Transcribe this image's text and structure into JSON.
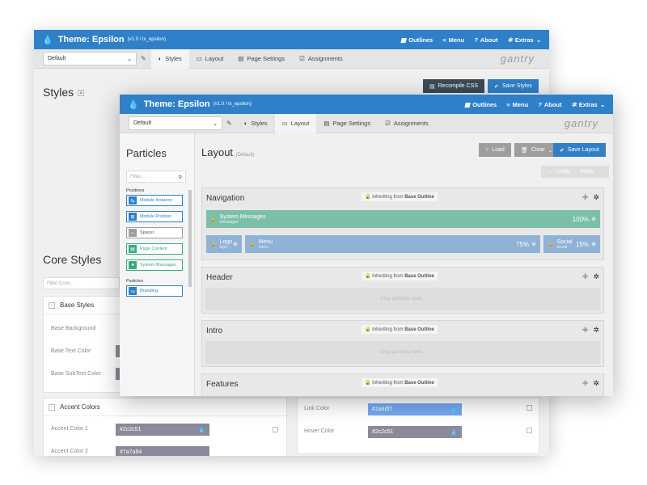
{
  "back": {
    "topbar": {
      "title": "Theme: Epsilon",
      "version": "(v1.0 / tx_epsilon)",
      "nav": [
        {
          "icon": "grid-icon",
          "glyph": "▦",
          "label": "Outlines"
        },
        {
          "icon": "menu-icon",
          "glyph": "≡",
          "label": "Menu"
        },
        {
          "icon": "help-icon",
          "glyph": "?",
          "label": "About"
        },
        {
          "icon": "gear-icon",
          "glyph": "✲",
          "label": "Extras"
        }
      ]
    },
    "outline_select": "Default",
    "tabs": [
      {
        "icon": "contrast-icon",
        "glyph": "◐",
        "label": "Styles",
        "active": true
      },
      {
        "icon": "layout-icon",
        "glyph": "▭",
        "label": "Layout",
        "active": false
      },
      {
        "icon": "list-icon",
        "glyph": "▤",
        "label": "Page Settings",
        "active": false
      },
      {
        "icon": "check-icon",
        "glyph": "☑",
        "label": "Assignments",
        "active": false
      }
    ],
    "brand": "gantry",
    "recompile_label": "Recompile CSS",
    "save_styles_label": "Save Styles",
    "styles_heading": "Styles",
    "core_styles_heading": "Core Styles",
    "filter_placeholder": "Filter Core...",
    "base_styles": {
      "title": "Base Styles",
      "fields": [
        "Base Background",
        "Base Text Color",
        "Base SubText Color"
      ]
    },
    "accent_colors": {
      "title": "Accent Colors",
      "fields": [
        {
          "label": "Accent Color 1",
          "value": "#2c2c51",
          "color": "#8a8a9a"
        },
        {
          "label": "Accent Color 2",
          "value": "#7a7a94",
          "color": "#8a8a9a"
        }
      ]
    },
    "link_colors": [
      {
        "label": "Link Color",
        "value": "#1a6df7",
        "color": "#75a8f0"
      },
      {
        "label": "Hover Color",
        "value": "#2c2c51",
        "color": "#8a8a9a"
      }
    ]
  },
  "front": {
    "topbar": {
      "title": "Theme: Epsilon",
      "version": "(v1.0 / tx_epsilon)",
      "nav": [
        {
          "icon": "grid-icon",
          "glyph": "▦",
          "label": "Outlines"
        },
        {
          "icon": "menu-icon",
          "glyph": "≡",
          "label": "Menu"
        },
        {
          "icon": "help-icon",
          "glyph": "?",
          "label": "About"
        },
        {
          "icon": "gear-icon",
          "glyph": "✲",
          "label": "Extras"
        }
      ]
    },
    "outline_select": "Default",
    "tabs": [
      {
        "icon": "contrast-icon",
        "glyph": "◐",
        "label": "Styles",
        "active": false
      },
      {
        "icon": "layout-icon",
        "glyph": "▭",
        "label": "Layout",
        "active": true
      },
      {
        "icon": "list-icon",
        "glyph": "▤",
        "label": "Page Settings",
        "active": false
      },
      {
        "icon": "check-icon",
        "glyph": "☑",
        "label": "Assignments",
        "active": false
      }
    ],
    "brand": "gantry",
    "particles_heading": "Particles",
    "filter_placeholder": "Filter...",
    "positions_label": "Positions",
    "particles_label": "Particles",
    "particle_items": [
      {
        "label": "Module Instance",
        "color": "#2f80c8",
        "glyph": "⇆"
      },
      {
        "label": "Module Position",
        "color": "#2f80c8",
        "glyph": "⊞"
      },
      {
        "label": "Spacer",
        "color": "#9e9e9e",
        "glyph": "↔"
      },
      {
        "label": "Page Content",
        "color": "#3aaa7e",
        "glyph": "▤"
      },
      {
        "label": "System Messages",
        "color": "#3aaa7e",
        "glyph": "●"
      },
      {
        "label": "Branding",
        "color": "#2f80c8",
        "glyph": "TM"
      }
    ],
    "layout_heading": "Layout",
    "layout_sub": "(Default)",
    "load_label": "Load",
    "clear_label": "Clear",
    "save_layout_label": "Save Layout",
    "undo_label": "Undo",
    "redo_label": "Redo",
    "inherit_prefix": "Inheriting from",
    "inherit_source": "Base Outline",
    "drop_text": "Drop particles here...",
    "sections": [
      {
        "name": "Navigation"
      },
      {
        "name": "Header"
      },
      {
        "name": "Intro"
      },
      {
        "name": "Features"
      }
    ],
    "nav_blocks": {
      "system": {
        "name": "System Messages",
        "sub": "messages",
        "pct": "100%",
        "color": "#7bbfa8"
      },
      "logo": {
        "name": "Logo",
        "sub": "logo",
        "color": "#8fb2d6"
      },
      "menu": {
        "name": "Menu",
        "sub": "menu",
        "pct": "75%",
        "color": "#8fb2d6"
      },
      "social": {
        "name": "Social",
        "sub": "social",
        "pct": "15%",
        "color": "#8fb2d6"
      }
    }
  }
}
